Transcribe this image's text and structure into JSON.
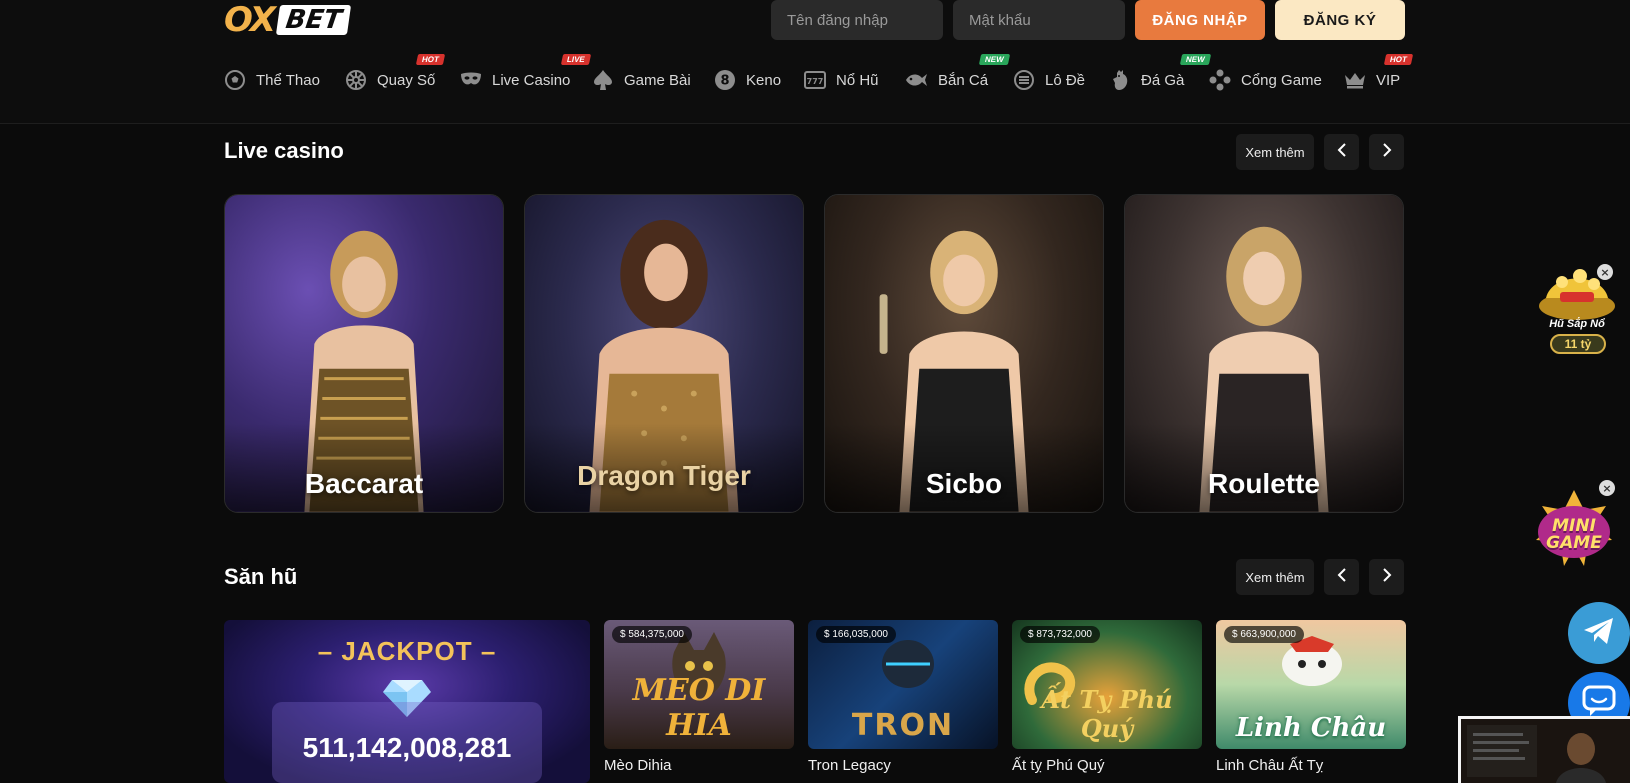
{
  "brand": {
    "logo_ox": "OX",
    "logo_bet": "BET"
  },
  "auth": {
    "username_placeholder": "Tên đăng nhập",
    "password_placeholder": "Mật khẩu",
    "login_label": "ĐĂNG NHẬP",
    "register_label": "ĐĂNG KÝ"
  },
  "nav": {
    "items": [
      {
        "label": "Thể Thao",
        "icon": "soccer-ball-icon",
        "badge": ""
      },
      {
        "label": "Quay Số",
        "icon": "lottery-wheel-icon",
        "badge": "HOT"
      },
      {
        "label": "Live Casino",
        "icon": "mask-icon",
        "badge": "LIVE"
      },
      {
        "label": "Game Bài",
        "icon": "spade-icon",
        "badge": ""
      },
      {
        "label": "Keno",
        "icon": "keno-ball-icon",
        "badge": ""
      },
      {
        "label": "Nổ Hũ",
        "icon": "slot-777-icon",
        "badge": ""
      },
      {
        "label": "Bắn Cá",
        "icon": "fish-icon",
        "badge": "NEW"
      },
      {
        "label": "Lô Đề",
        "icon": "lotto-icon",
        "badge": ""
      },
      {
        "label": "Đá Gà",
        "icon": "rooster-icon",
        "badge": "NEW"
      },
      {
        "label": "Cổng Game",
        "icon": "gamepad-icon",
        "badge": ""
      },
      {
        "label": "VIP",
        "icon": "crown-icon",
        "badge": "HOT"
      }
    ]
  },
  "live_casino": {
    "title": "Live casino",
    "more_label": "Xem thêm",
    "cards": [
      {
        "label": "Baccarat"
      },
      {
        "label": "Dragon Tiger"
      },
      {
        "label": "Sicbo"
      },
      {
        "label": "Roulette"
      }
    ]
  },
  "jackpot_section": {
    "title": "Săn hũ",
    "more_label": "Xem thêm",
    "jackpot": {
      "title": "– JACKPOT –",
      "amount": "511,142,008,281"
    },
    "games": [
      {
        "name": "Mèo Dihia",
        "prize": "$ 584,375,000",
        "art": "MEO DI HIA"
      },
      {
        "name": "Tron Legacy",
        "prize": "$ 166,035,000",
        "art": "TRON"
      },
      {
        "name": "Ất tỵ Phú Quý",
        "prize": "$ 873,732,000",
        "art": "Ất Tỵ Phú Quý"
      },
      {
        "name": "Linh Châu Ất Tỵ",
        "prize": "$ 663,900,000",
        "art": "Linh Châu"
      }
    ]
  },
  "floating": {
    "hu_sap_no_label": "Hũ Sắp Nổ",
    "hu_sap_no_amount": "11 tỷ",
    "minigame_label": "MINI GAME"
  }
}
